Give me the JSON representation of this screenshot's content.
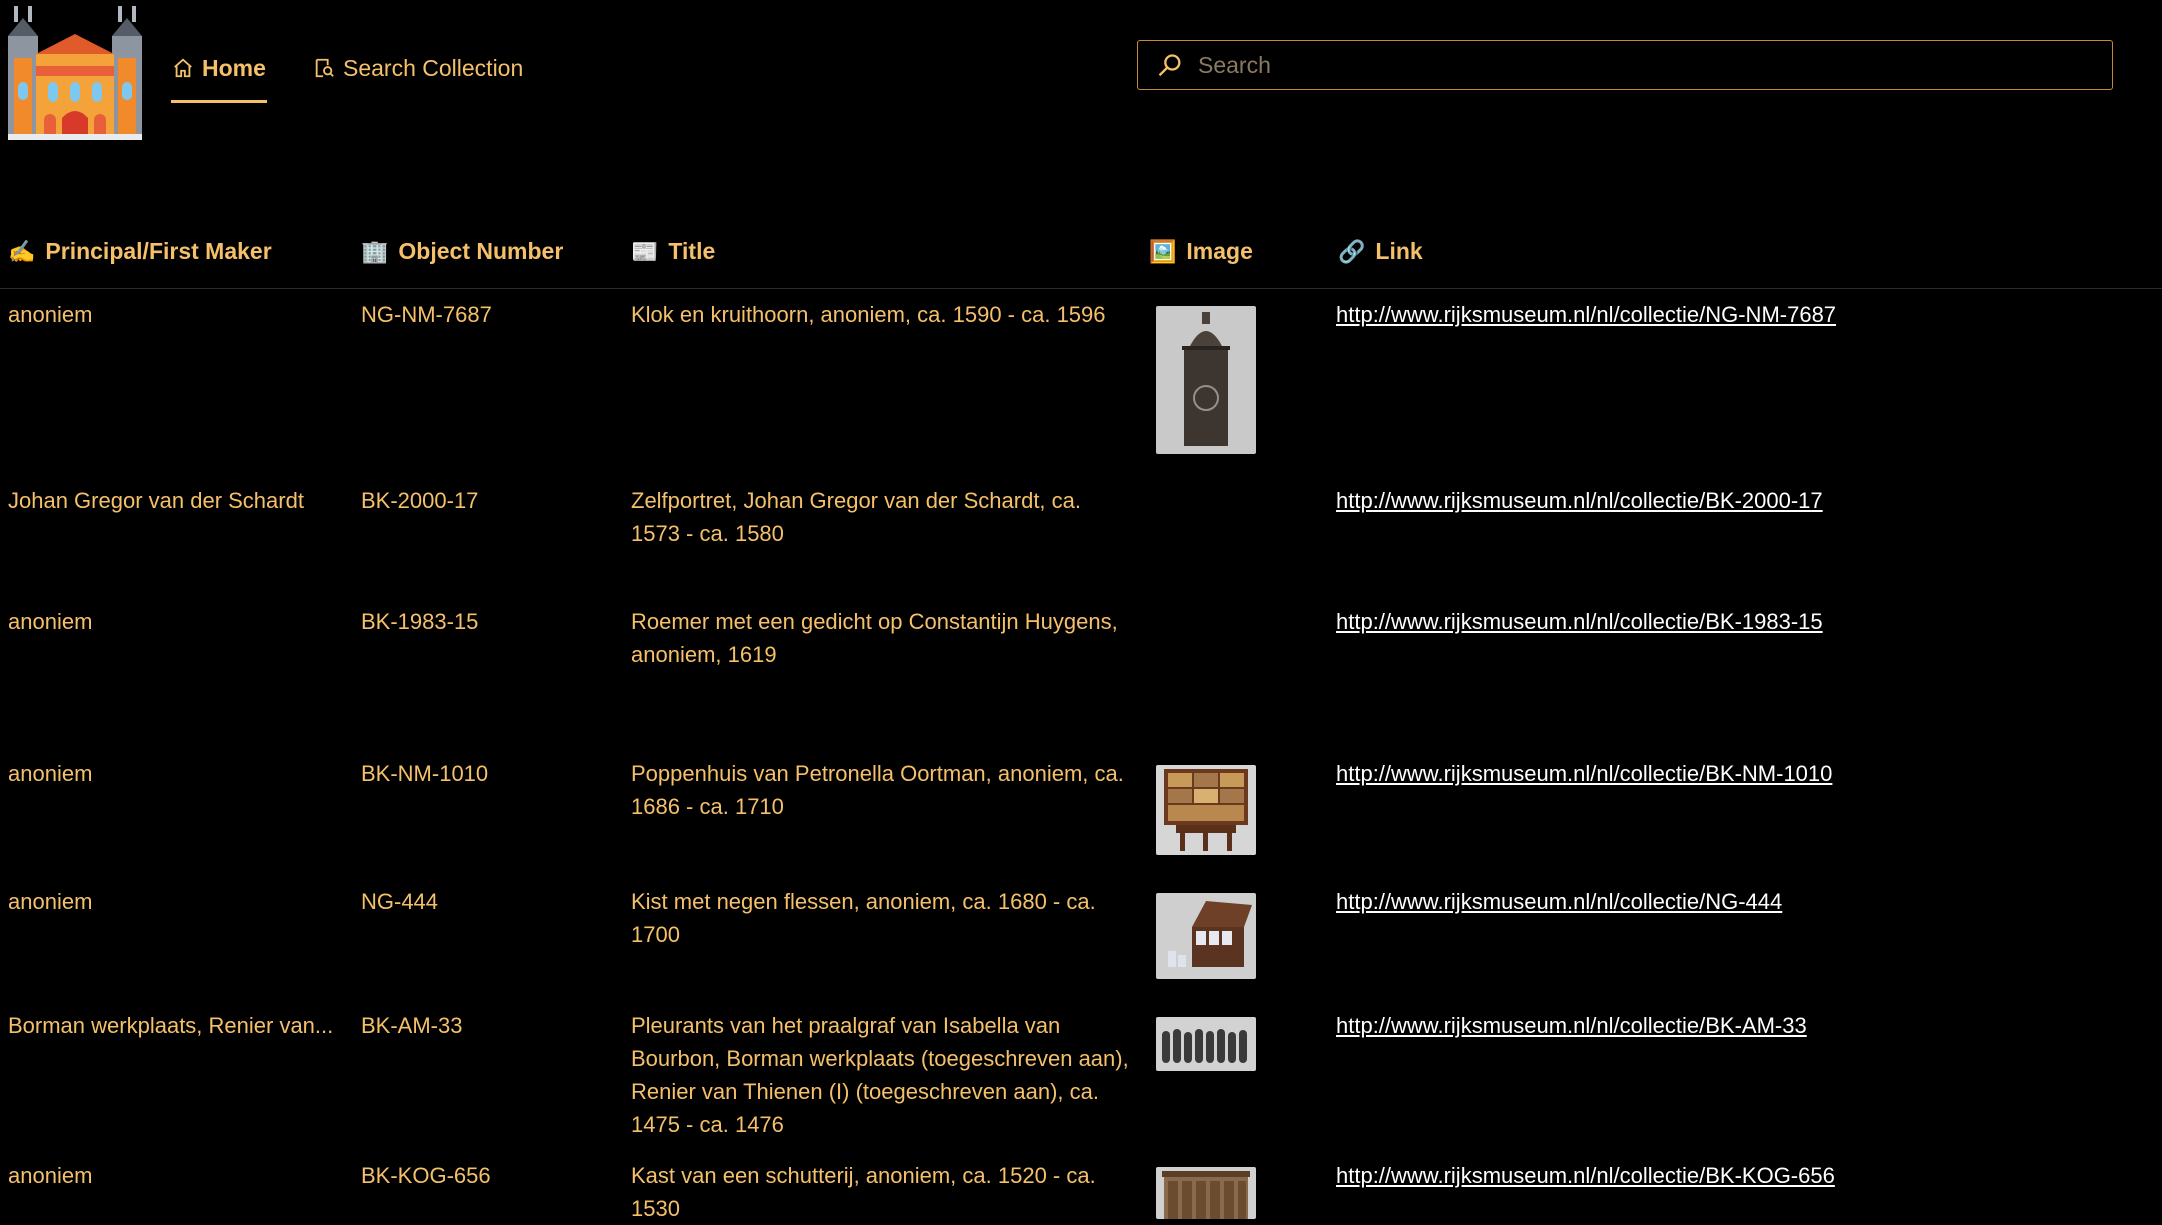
{
  "nav": {
    "home_label": "Home",
    "search_collection_label": "Search Collection"
  },
  "search": {
    "placeholder": "Search",
    "value": ""
  },
  "table": {
    "headers": {
      "maker": "Principal/First Maker",
      "object_number": "Object Number",
      "title": "Title",
      "image": "Image",
      "link": "Link"
    },
    "header_icons": {
      "maker": "writing-hand-icon",
      "object_number": "building-icon",
      "title": "newspaper-icon",
      "image": "picture-icon",
      "link": "link-icon"
    },
    "rows": [
      {
        "maker": "anoniem",
        "object_number": "NG-NM-7687",
        "title": "Klok en kruithoorn, anoniem, ca. 1590 - ca. 1596",
        "link": "http://www.rijksmuseum.nl/nl/collectie/NG-NM-7687",
        "has_image": true
      },
      {
        "maker": "Johan Gregor van der Schardt",
        "object_number": "BK-2000-17",
        "title": "Zelfportret, Johan Gregor van der Schardt, ca. 1573 - ca. 1580",
        "link": "http://www.rijksmuseum.nl/nl/collectie/BK-2000-17",
        "has_image": false
      },
      {
        "maker": "anoniem",
        "object_number": "BK-1983-15",
        "title": "Roemer met een gedicht op Constantijn Huygens, anoniem, 1619",
        "link": "http://www.rijksmuseum.nl/nl/collectie/BK-1983-15",
        "has_image": false
      },
      {
        "maker": "anoniem",
        "object_number": "BK-NM-1010",
        "title": "Poppenhuis van Petronella Oortman, anoniem, ca. 1686 - ca. 1710",
        "link": "http://www.rijksmuseum.nl/nl/collectie/BK-NM-1010",
        "has_image": true
      },
      {
        "maker": "anoniem",
        "object_number": "NG-444",
        "title": "Kist met negen flessen, anoniem, ca. 1680 - ca. 1700",
        "link": "http://www.rijksmuseum.nl/nl/collectie/NG-444",
        "has_image": true
      },
      {
        "maker": "Borman werkplaats, Renier van...",
        "object_number": "BK-AM-33",
        "title": "Pleurants van het praalgraf van Isabella van Bourbon, Borman werkplaats (toegeschreven aan), Renier van Thienen (I) (toegeschreven aan), ca. 1475 - ca. 1476",
        "link": "http://www.rijksmuseum.nl/nl/collectie/BK-AM-33",
        "has_image": true
      },
      {
        "maker": "anoniem",
        "object_number": "BK-KOG-656",
        "title": "Kast van een schutterij, anoniem, ca. 1520 - ca. 1530",
        "link": "http://www.rijksmuseum.nl/nl/collectie/BK-KOG-656",
        "has_image": true
      }
    ]
  },
  "colors": {
    "accent": "#f5c06a",
    "background": "#000000",
    "link": "#ffffff",
    "search_border": "#c48a3a"
  }
}
